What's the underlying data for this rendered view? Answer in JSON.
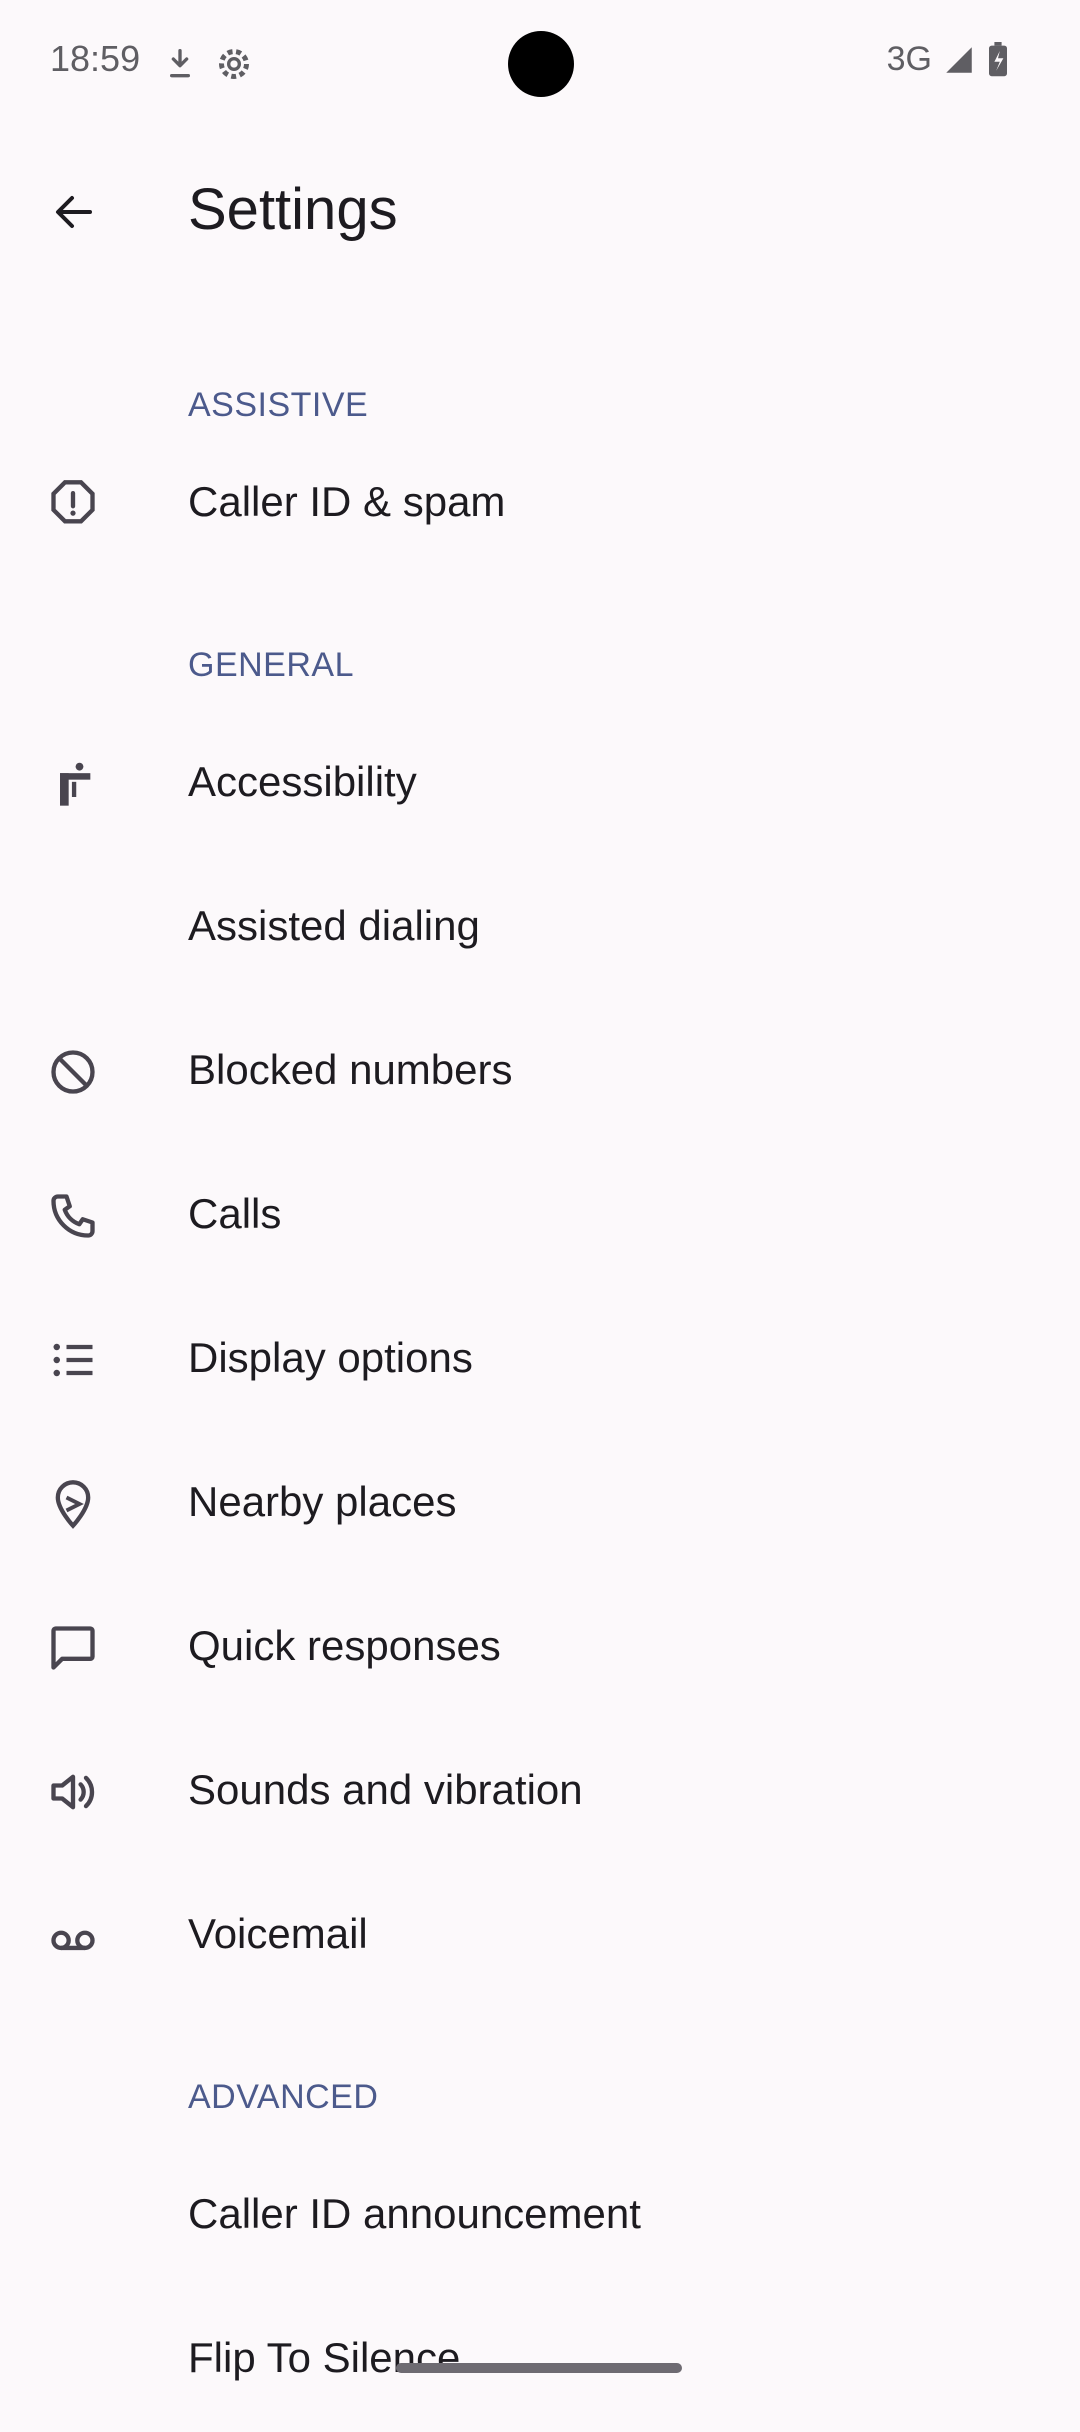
{
  "status_bar": {
    "time": "18:59",
    "network": "3G",
    "icons": [
      "download-icon",
      "settings-gear-icon",
      "signal-icon",
      "battery-charging-icon"
    ]
  },
  "app_bar": {
    "title": "Settings",
    "back_icon": "arrow-back-icon"
  },
  "sections": {
    "assistive": {
      "header": "ASSISTIVE",
      "items": [
        {
          "label": "Caller ID & spam",
          "icon": "spam-alert-icon"
        }
      ]
    },
    "general": {
      "header": "GENERAL",
      "items": [
        {
          "label": "Accessibility",
          "icon": "accessibility-icon"
        },
        {
          "label": "Assisted dialing",
          "icon": ""
        },
        {
          "label": "Blocked numbers",
          "icon": "block-icon"
        },
        {
          "label": "Calls",
          "icon": "phone-icon"
        },
        {
          "label": "Display options",
          "icon": "list-icon"
        },
        {
          "label": "Nearby places",
          "icon": "location-pin-icon"
        },
        {
          "label": "Quick responses",
          "icon": "chat-bubble-icon"
        },
        {
          "label": "Sounds and vibration",
          "icon": "volume-icon"
        },
        {
          "label": "Voicemail",
          "icon": "voicemail-icon"
        }
      ]
    },
    "advanced": {
      "header": "ADVANCED",
      "items": [
        {
          "label": "Caller ID announcement",
          "icon": ""
        },
        {
          "label": "Flip To Silence",
          "icon": ""
        }
      ]
    }
  },
  "colors": {
    "background": "#fcf9fb",
    "section_header": "#4c5a8c",
    "text_primary": "#1d1b20",
    "icon": "#49454f"
  }
}
